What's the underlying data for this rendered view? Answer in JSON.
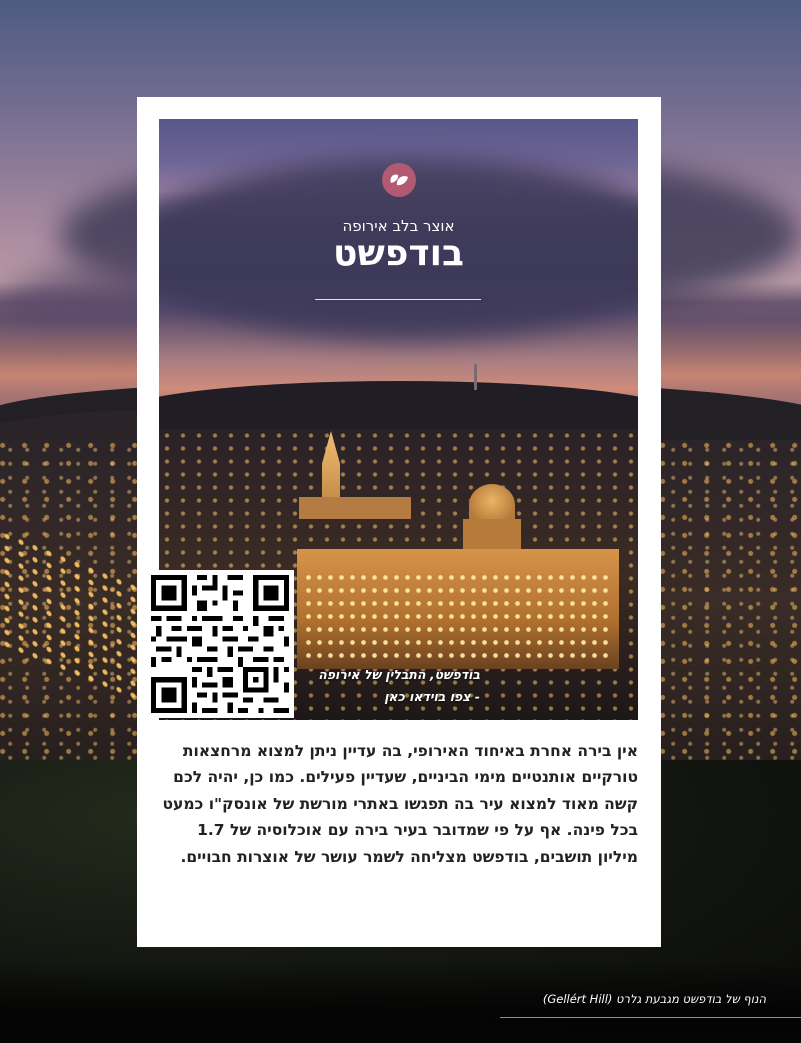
{
  "header": {
    "subtitle": "אוצר בלב אירופה",
    "title": "בודפשט",
    "logo_icon": "heart-leaf-icon",
    "logo_color": "#b25a72"
  },
  "qr": {
    "icon": "qr-code-icon"
  },
  "video_caption": {
    "line1": "בודפשט, התבלין של אירופה",
    "line2": "- צפו בוידאו כאן"
  },
  "body": {
    "paragraph": "אין בירה אחרת באיחוד האירופי, בה עדיין ניתן למצוא מרחצאות טורקיים אותנטיים מימי הביניים, שעדיין פעילים. כמו כן, יהיה לכם קשה מאוד למצוא עיר בה תפגשו באתרי מורשת של אונסק\"ו כמעט בכל פינה. אף על פי שמדובר בעיר בירה עם אוכלוסיה של 1.7 מיליון תושבים, בודפשט מצליחה לשמר עושר של אוצרות חבויים."
  },
  "photo_credit": "הנוף של בודפשט מגבעת גלרט (Gellért Hill)"
}
